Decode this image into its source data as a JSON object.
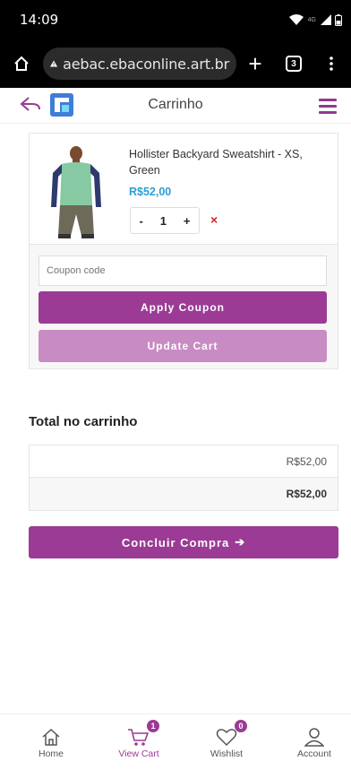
{
  "status_bar": {
    "time": "14:09",
    "network": "4G"
  },
  "browser": {
    "url": "aebac.ebaconline.art.br",
    "tab_count": "3",
    "new_tab": "+"
  },
  "header": {
    "title": "Carrinho"
  },
  "cart": {
    "items": [
      {
        "name": "Hollister Backyard Sweatshirt - XS, Green",
        "price": "R$52,00",
        "qty": "1",
        "minus": "-",
        "plus": "+",
        "remove": "×"
      }
    ],
    "coupon_placeholder": "Coupon code",
    "apply_label": "Apply Coupon",
    "update_label": "Update Cart"
  },
  "totals": {
    "title": "Total no carrinho",
    "subtotal": "R$52,00",
    "total": "R$52,00"
  },
  "checkout": {
    "label": "Concluir Compra",
    "arrow": "➔"
  },
  "bottom_nav": [
    {
      "label": "Home",
      "icon": "home-icon"
    },
    {
      "label": "View Cart",
      "icon": "cart-icon",
      "badge": "1"
    },
    {
      "label": "Wishlist",
      "icon": "heart-icon",
      "badge": "0"
    },
    {
      "label": "Account",
      "icon": "user-icon"
    }
  ],
  "colors": {
    "brand": "#9b3b95",
    "brand_light": "#c98bc4",
    "price": "#2a9fd6",
    "remove": "#e02020"
  }
}
